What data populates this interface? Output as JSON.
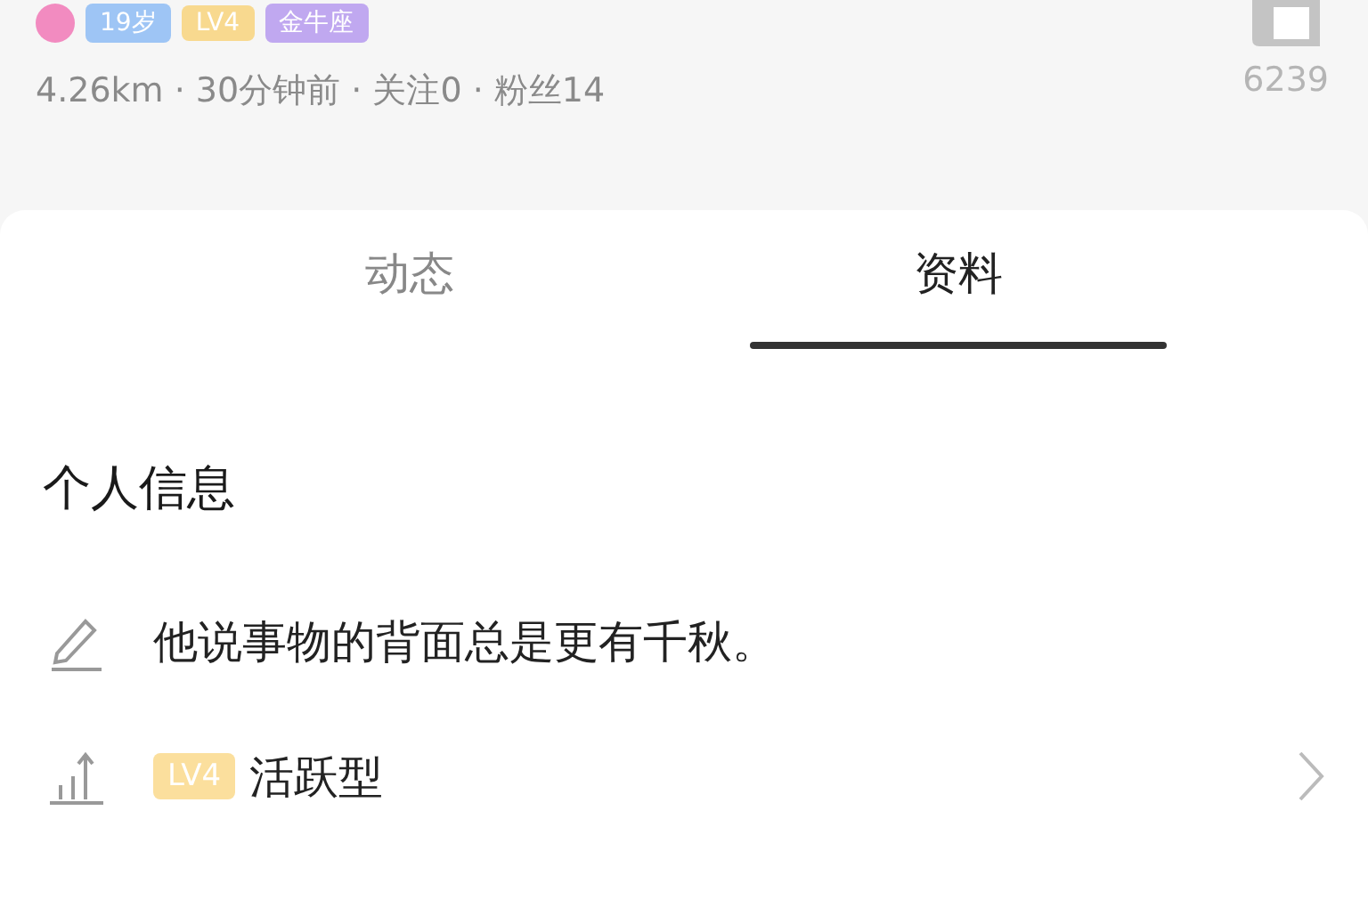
{
  "profile": {
    "badges": [
      {
        "text": "19岁",
        "color": "#9ec5f5"
      },
      {
        "text": "LV4",
        "color": "#f8d98f"
      },
      {
        "text": "金牛座",
        "color": "#c0a8f0"
      }
    ],
    "meta": "4.26km · 30分钟前 · 关注0 · 粉丝14",
    "likes": "6239"
  },
  "tabs": [
    {
      "label": "动态",
      "selected": false
    },
    {
      "label": "资料",
      "selected": true
    }
  ],
  "section": {
    "title": "个人信息",
    "rows": [
      {
        "kind": "signature",
        "text": "他说事物的背面总是更有千秋。"
      },
      {
        "kind": "level",
        "badge": "LV4",
        "text": "活跃型"
      }
    ]
  }
}
